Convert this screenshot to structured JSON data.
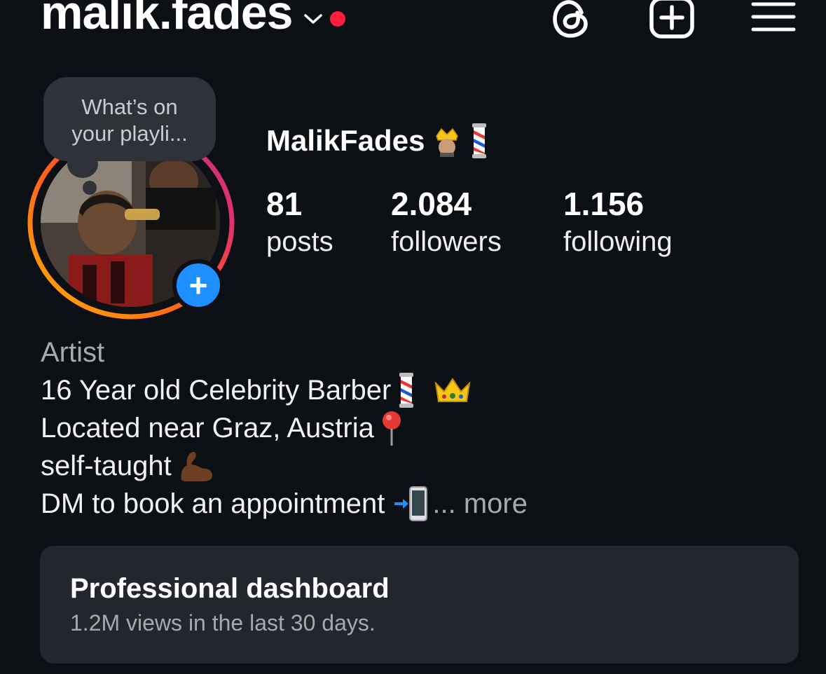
{
  "header": {
    "username": "malik.fades",
    "icons": [
      "chevron-down-icon",
      "notification-dot",
      "threads-icon",
      "create-plus-icon",
      "menu-icon"
    ]
  },
  "note": {
    "text_line1": "What’s on",
    "text_line2": "your playli..."
  },
  "profile": {
    "display_name": "MalikFades",
    "stats": {
      "posts": {
        "value": "81",
        "label": "posts"
      },
      "followers": {
        "value": "2.084",
        "label": "followers"
      },
      "following": {
        "value": "1.156",
        "label": "following"
      }
    }
  },
  "bio": {
    "category": "Artist",
    "line1": "16 Year old Celebrity Barber",
    "line2": "Located near Graz, Austria",
    "line3": "self-taught",
    "line4": "DM to book an appointment",
    "more_label": "... more"
  },
  "dashboard": {
    "title": "Professional dashboard",
    "subtitle": "1.2M views in the last 30 days."
  },
  "colors": {
    "background": "#0c0f14",
    "card": "#23262c",
    "accent_blue": "#1e90ff",
    "notification_red": "#ff1e3c",
    "muted_text": "#a7a9ae"
  }
}
